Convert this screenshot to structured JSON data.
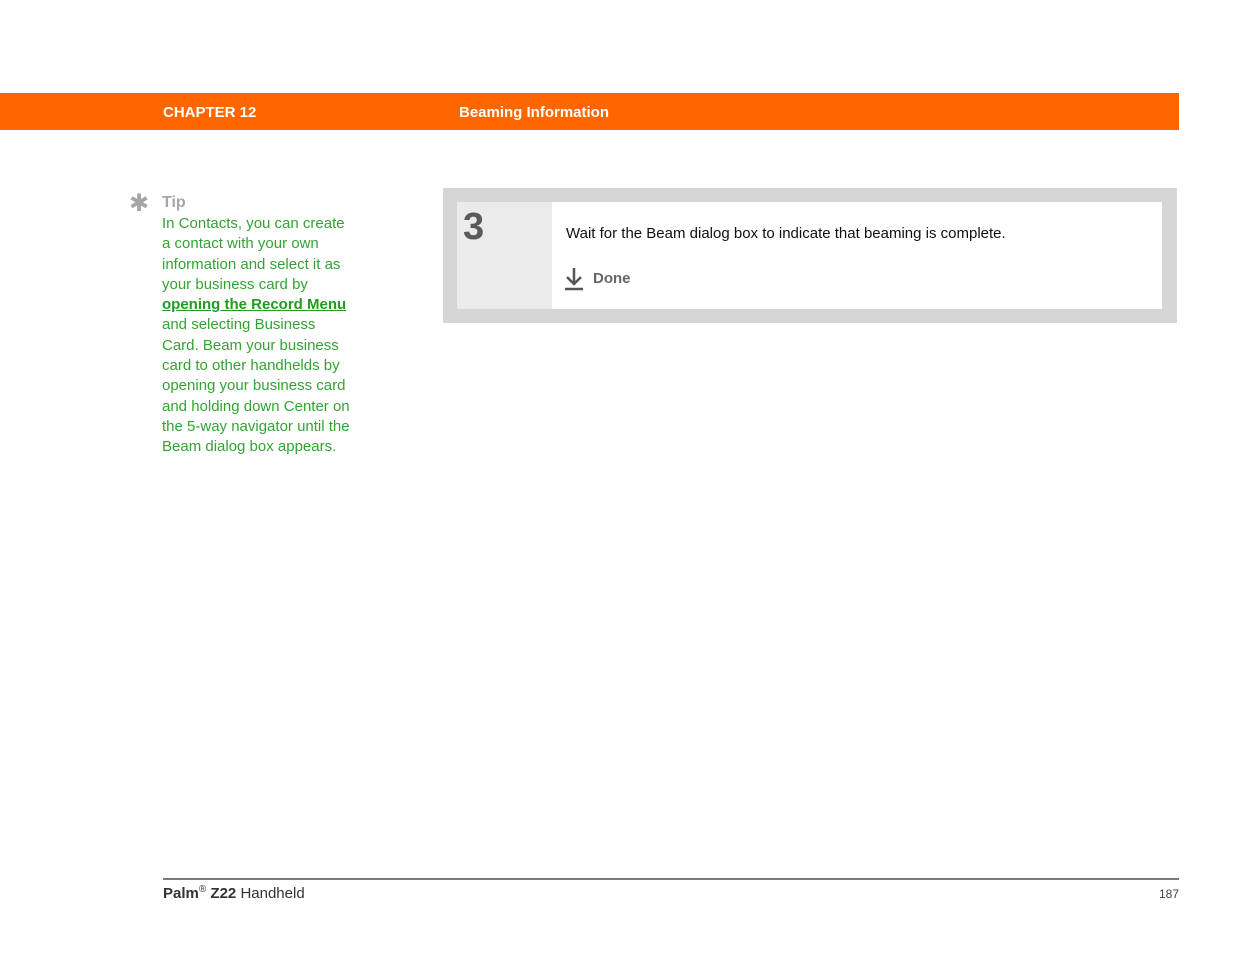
{
  "header": {
    "chapter": "CHAPTER 12",
    "title": "Beaming Information",
    "bar_color": "#ff6600"
  },
  "tip": {
    "icon": "asterisk-icon",
    "heading": "Tip",
    "text_before": "In Contacts, you can create a contact with your own information and select it as your business card by ",
    "link_text": "opening the Record Menu",
    "text_after": " and selecting Business Card. Beam your business card to other handhelds by opening your business card and holding down Center on the 5-way navigator until the Beam dialog box appears.",
    "color": "#33a333"
  },
  "step": {
    "number": "3",
    "text": "Wait for the Beam dialog box to indicate that beaming is complete.",
    "done_icon": "down-arrow-icon",
    "done_label": "Done"
  },
  "footer": {
    "brand": "Palm",
    "registered": "®",
    "model": "Z22",
    "suffix": "Handheld",
    "page_number": "187"
  }
}
